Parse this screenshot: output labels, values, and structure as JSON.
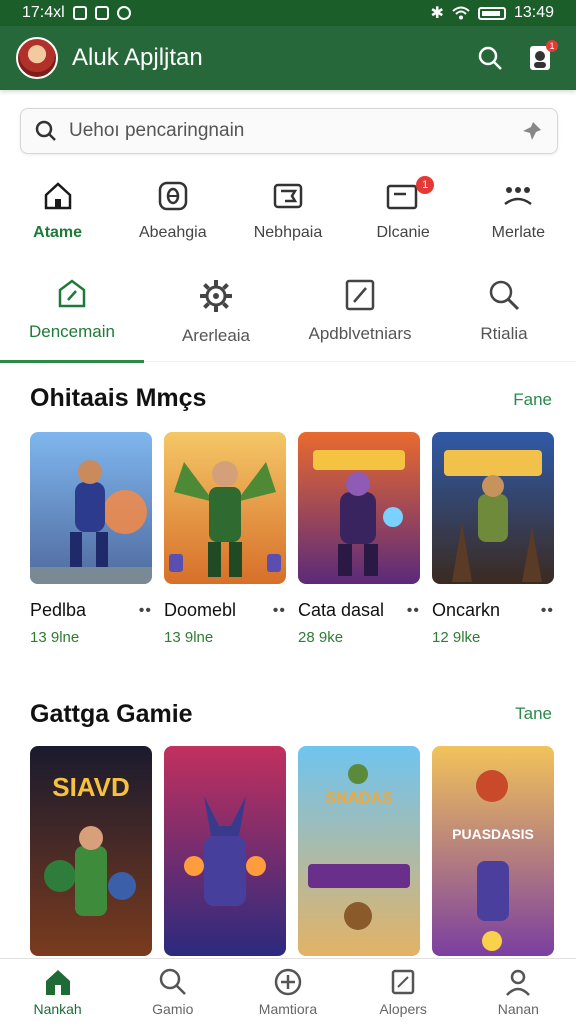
{
  "status_bar": {
    "time_left": "17:4xl",
    "time_right": "13:49"
  },
  "app_bar": {
    "title": "Aluk Apjljtan",
    "notif_count": "1"
  },
  "search": {
    "placeholder": "Uehoı pencaringnain"
  },
  "categories": [
    {
      "label": "Atame",
      "icon": "home-icon"
    },
    {
      "label": "Abeahgia",
      "icon": "game-icon"
    },
    {
      "label": "Nebhpaia",
      "icon": "flag-icon"
    },
    {
      "label": "Dlcanie",
      "icon": "mail-icon",
      "badge": "1"
    },
    {
      "label": "Merlate",
      "icon": "group-icon"
    }
  ],
  "tabs": [
    {
      "label": "Dencemain",
      "icon": "tag-icon"
    },
    {
      "label": "Arerleaia",
      "icon": "gear-icon"
    },
    {
      "label": "Apdblvetniars",
      "icon": "edit-icon"
    },
    {
      "label": "Rtialia",
      "icon": "search-icon"
    }
  ],
  "section1": {
    "title": "Ohitaais Mmçs",
    "more": "Fane",
    "items": [
      {
        "name": "Pedlba",
        "meta": "13 9lne"
      },
      {
        "name": "Doomebl",
        "meta": "13 9lne"
      },
      {
        "name": "Cata dasal",
        "meta": "28 9ke"
      },
      {
        "name": "Oncarkn",
        "meta": "12 9lke"
      }
    ]
  },
  "section2": {
    "title": "Gattga Gamie",
    "more": "Tane",
    "banners": [
      "SIAVD",
      "",
      "SNADAS",
      "PUASDASIS"
    ]
  },
  "bottom_nav": [
    {
      "label": "Nankah"
    },
    {
      "label": "Gamio"
    },
    {
      "label": "Mamtiora"
    },
    {
      "label": "Alopers"
    },
    {
      "label": "Nanan"
    }
  ],
  "colors": {
    "primary": "#26683a",
    "accent": "#2a8a46",
    "badge": "#e53935"
  }
}
